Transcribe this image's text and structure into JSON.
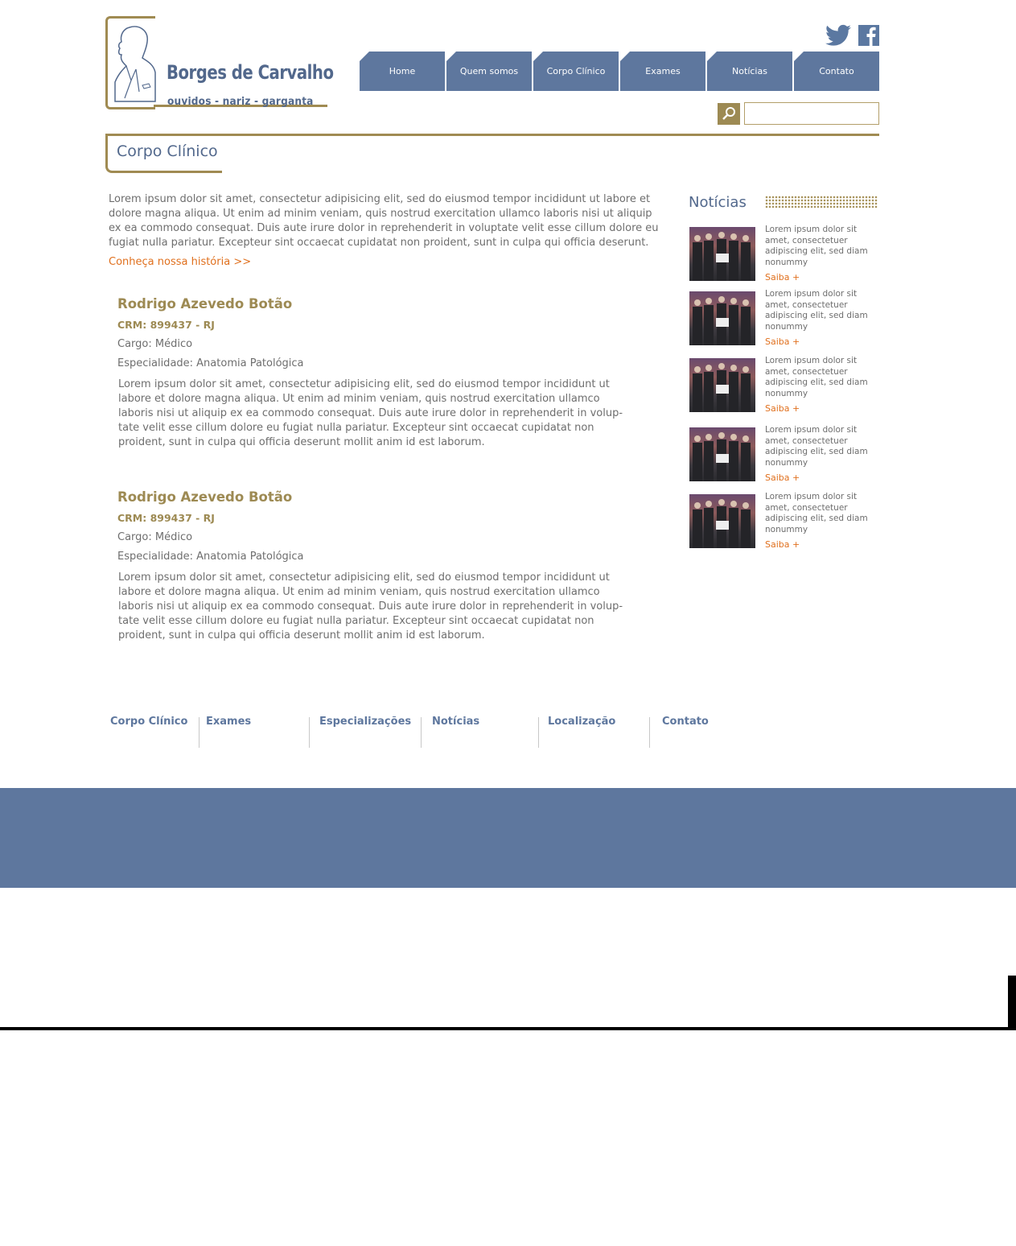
{
  "logo": {
    "brand": "Borges de Carvalho",
    "tagline": "ouvidos - nariz - garganta"
  },
  "social": {
    "twitter_icon": "twitter-icon",
    "facebook_icon": "facebook-icon"
  },
  "nav": {
    "items": [
      "Home",
      "Quem somos",
      "Corpo Clínico",
      "Exames",
      "Notícias",
      "Contato"
    ]
  },
  "search": {
    "icon": "search-icon",
    "value": ""
  },
  "page": {
    "title": "Corpo Clínico",
    "intro": "Lorem ipsum dolor sit amet, consectetur adipisicing elit, sed do eiusmod tempor incididunt ut labore et dolore magna aliqua. Ut enim ad minim veniam, quis nostrud exercitation ullamco laboris nisi ut aliquip ex ea commodo consequat. Duis aute irure dolor in reprehenderit in voluptate velit esse cillum dolore eu fugiat nulla pariatur. Excepteur sint occaecat cupidatat non proident, sunt in culpa qui officia deserunt.",
    "history_link": "Conheça nossa história >>"
  },
  "doctors": [
    {
      "name": "Rodrigo Azevedo Botão",
      "crm": "CRM: 899437 - RJ",
      "cargo": "Cargo: Médico",
      "especialidade": "Especialidade: Anatomia Patológica",
      "bio": "Lorem ipsum dolor sit amet, consectetur adipisicing elit, sed do eiusmod tempor incididunt ut labore et dolore magna aliqua. Ut enim ad minim veniam, quis nostrud exercitation ullamco laboris nisi ut aliquip ex ea commodo consequat. Duis aute irure dolor in reprehenderit in volup-tate velit esse cillum dolore eu fugiat nulla pariatur. Excepteur sint occaecat cupidatat non proident, sunt in culpa qui officia deserunt mollit anim id est laborum."
    },
    {
      "name": "Rodrigo Azevedo Botão",
      "crm": "CRM: 899437 - RJ",
      "cargo": "Cargo: Médico",
      "especialidade": "Especialidade: Anatomia Patológica",
      "bio": "Lorem ipsum dolor sit amet, consectetur adipisicing elit, sed do eiusmod tempor incididunt ut labore et dolore magna aliqua. Ut enim ad minim veniam, quis nostrud exercitation ullamco laboris nisi ut aliquip ex ea commodo consequat. Duis aute irure dolor in reprehenderit in volup-tate velit esse cillum dolore eu fugiat nulla pariatur. Excepteur sint occaecat cupidatat non proident, sunt in culpa qui officia deserunt mollit anim id est laborum."
    }
  ],
  "sidebar": {
    "title": "Notícias",
    "items": [
      {
        "text": "Lorem ipsum dolor sit amet, consectetuer adipiscing elit, sed diam nonummy",
        "more": "Saiba +"
      },
      {
        "text": "Lorem ipsum dolor sit amet, consectetuer adipiscing elit, sed diam nonummy",
        "more": "Saiba +"
      },
      {
        "text": "Lorem ipsum dolor sit amet, consectetuer adipiscing elit, sed diam nonummy",
        "more": "Saiba +"
      },
      {
        "text": "Lorem ipsum dolor sit amet, consectetuer adipiscing elit, sed diam nonummy",
        "more": "Saiba +"
      },
      {
        "text": "Lorem ipsum dolor sit amet, consectetuer adipiscing elit, sed diam nonummy",
        "more": "Saiba +"
      }
    ]
  },
  "footer": {
    "links": [
      "Corpo Clínico",
      "Exames",
      "Especializações",
      "Notícias",
      "Localização",
      "Contato"
    ]
  },
  "colors": {
    "navy": "#5e779e",
    "gold": "#a08b52",
    "orange": "#e0701e"
  }
}
